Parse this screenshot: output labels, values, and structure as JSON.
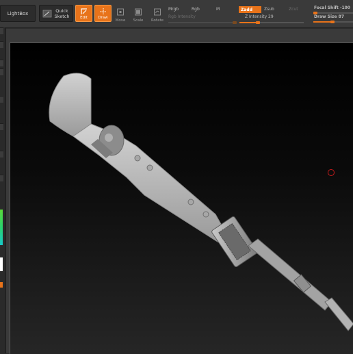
{
  "toolbar": {
    "lightbox_label": "LightBox",
    "quicksketch_label_1": "Quick",
    "quicksketch_label_2": "Sketch",
    "edit_label": "Edit",
    "draw_label": "Draw",
    "move_label": "Move",
    "scale_label": "Scale",
    "rotate_label": "Rotate",
    "mrgb_label": "Mrgb",
    "rgb_label": "Rgb",
    "m_label": "M",
    "rgb_intensity_label": "Rgb Intensity",
    "zadd_label": "Zadd",
    "zsub_label": "Zsub",
    "zcut_label": "Zcut",
    "z_intensity_label": "Z Intensity 29",
    "focal_shift_label": "Focal Shift",
    "focal_shift_value": "-100",
    "draw_size_label": "Draw Size",
    "draw_size_value": "87",
    "z_intensity_level": 29,
    "focal_shift_level": -100,
    "draw_size_level": 87
  },
  "colors": {
    "accent": "#e8731a",
    "cursor": "#c41b1b"
  },
  "icons": [
    "lightbox-icon",
    "quicksketch-icon",
    "edit-icon",
    "draw-icon",
    "move-icon",
    "scale-icon",
    "rotate-icon"
  ]
}
